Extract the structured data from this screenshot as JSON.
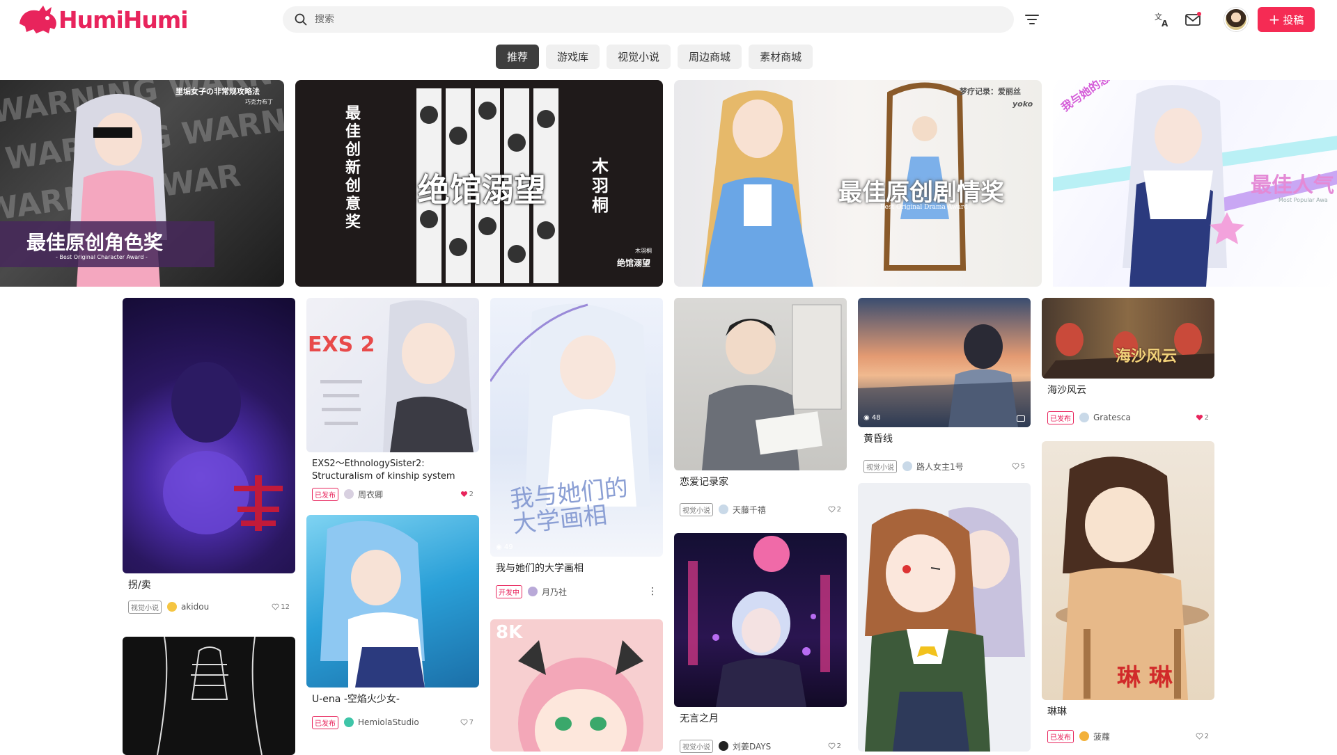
{
  "header": {
    "logo_text": "HumiHumi",
    "search_placeholder": "搜索",
    "submit_label": "投稿"
  },
  "tabs": [
    {
      "label": "推荐",
      "active": true
    },
    {
      "label": "游戏库",
      "active": false
    },
    {
      "label": "视觉小说",
      "active": false
    },
    {
      "label": "周边商城",
      "active": false
    },
    {
      "label": "素材商城",
      "active": false
    }
  ],
  "banners": [
    {
      "title": "最佳原创角色奖",
      "subtitle": "- Best Original Character Award -",
      "game": "里垢女子の非常规攻略法",
      "author": "巧克力布丁"
    },
    {
      "title": "绝馆溺望",
      "award": "最佳创新创意奖",
      "vertical_name": "木羽桐",
      "caption_author": "木羽桐",
      "caption_game": "绝馆溺望"
    },
    {
      "title": "最佳原创剧情奖",
      "subtitle": "Best Original Drama Award",
      "game": "梦疗记录：爱丽丝",
      "author": "yoko"
    },
    {
      "title": "最佳人气",
      "subtitle": "Most Popular Awa",
      "game": "我与她的恋爱面试会"
    }
  ],
  "cards": [
    {
      "title": "拐/卖",
      "tag": "视觉小说",
      "author": "akidou",
      "likes": "12"
    },
    {
      "title": "EXS2～EthnologySister2:\nStructuralism of kinship system",
      "tag": "已发布",
      "author": "周衣卿",
      "likes": "2"
    },
    {
      "title": "U-ena -空焰火少女-",
      "tag": "已发布",
      "author": "HemiolaStudio",
      "likes": "7"
    },
    {
      "title": "我与她们的大学画相",
      "tag": "开发中",
      "author": "月乃社",
      "views": "49"
    },
    {
      "title": "恋爱记录家",
      "tag": "视觉小说",
      "author": "天藤千禧",
      "likes": "2"
    },
    {
      "title": "无言之月",
      "tag": "视觉小说",
      "author": "刘姜DAYS",
      "likes": "2"
    },
    {
      "title": "黄昏线",
      "tag": "视觉小说",
      "author": "路人女主1号",
      "likes": "5",
      "views": "48"
    },
    {
      "title": "海沙风云",
      "tag": "已发布",
      "author": "Gratesca",
      "likes": "2"
    },
    {
      "title": "琳琳",
      "tag": "已发布",
      "author": "菠蘿",
      "likes": "2"
    }
  ],
  "thumb_text": {
    "exs_logo": "EXS 2",
    "uni_title": "我与她们的大学画相",
    "anya_badge": "8K",
    "haisha_title": "海沙风云",
    "linlin_sig": "琳 琳"
  }
}
